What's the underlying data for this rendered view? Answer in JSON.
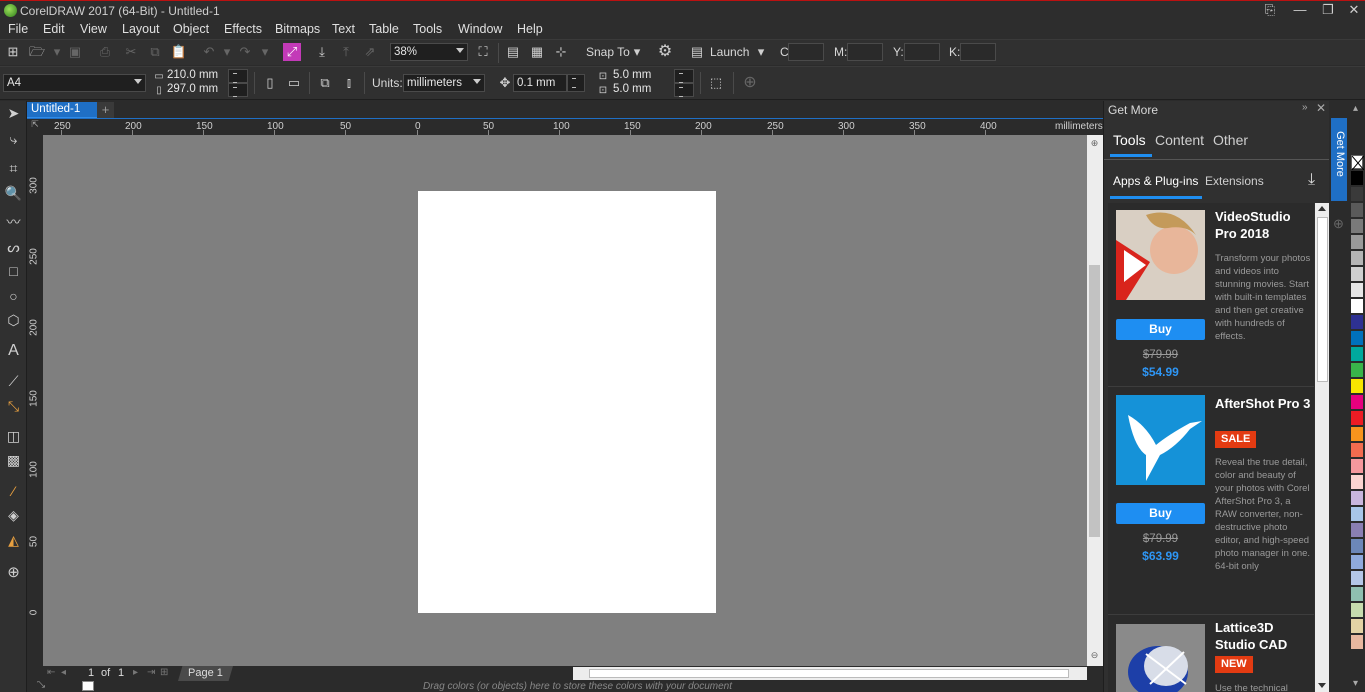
{
  "window": {
    "title": "CorelDRAW 2017 (64-Bit) - Untitled-1"
  },
  "menu": [
    "File",
    "Edit",
    "View",
    "Layout",
    "Object",
    "Effects",
    "Bitmaps",
    "Text",
    "Table",
    "Tools",
    "Window",
    "Help"
  ],
  "toolbar": {
    "zoom": "38%",
    "snap_to": "Snap To",
    "launch": "Launch",
    "x_label": "C:",
    "m_label": "M:",
    "y_label": "Y:",
    "k_label": "K:"
  },
  "properties": {
    "page_size": "A4",
    "width": "210.0 mm",
    "height": "297.0 mm",
    "units_label": "Units:",
    "units": "millimeters",
    "nudge": "0.1 mm",
    "dup_x": "5.0 mm",
    "dup_y": "5.0 mm"
  },
  "document": {
    "tab": "Untitled-1",
    "ruler_unit": "millimeters",
    "h_ruler_labels": [
      "250",
      "200",
      "150",
      "100",
      "50",
      "0",
      "50",
      "100",
      "150",
      "200",
      "250",
      "300",
      "350",
      "400"
    ],
    "v_ruler_labels": [
      "300",
      "250",
      "200",
      "150",
      "100",
      "50",
      "0"
    ],
    "page_nav": {
      "current": "1",
      "of": "of",
      "total": "1"
    },
    "page_tab": "Page 1",
    "status_hint": "Drag colors (or objects) here to store these colors with your document"
  },
  "get_more": {
    "title": "Get More",
    "side_tab": "Get More",
    "tabs": [
      "Tools",
      "Content",
      "Other"
    ],
    "subtabs": [
      "Apps & Plug-ins",
      "Extensions"
    ],
    "products": [
      {
        "name": "VideoStudio Pro 2018",
        "badge": "",
        "desc": "Transform your photos and videos into stunning movies. Start with built-in templates and then get creative with hundreds of effects.",
        "buy": "Buy",
        "old_price": "$79.99",
        "new_price": "$54.99"
      },
      {
        "name": "AfterShot Pro 3",
        "badge": "SALE",
        "desc": "Reveal the true detail, color and beauty of your photos with Corel AfterShot Pro 3, a RAW converter, non-destructive photo editor, and high-speed photo manager in one. 64-bit only",
        "buy": "Buy",
        "old_price": "$79.99",
        "new_price": "$63.99"
      },
      {
        "name": "Lattice3D Studio CAD",
        "badge": "NEW",
        "desc": "Use the technical",
        "buy": "",
        "old_price": "",
        "new_price": ""
      }
    ]
  },
  "colors": {
    "accent": "#1f6fc5",
    "canvas": "#7f7f7f",
    "buy_button": "#1e8ef2",
    "badge": "#e33b12"
  },
  "palette": [
    "#000000",
    "#3a3a3a",
    "#5a5a5a",
    "#7a7a7a",
    "#9a9a9a",
    "#b5b5b5",
    "#cfcfcf",
    "#e6e6e6",
    "#ffffff",
    "#2e3192",
    "#0071bc",
    "#00a99d",
    "#39b54a",
    "#f7e600",
    "#e6007e",
    "#ed1c24",
    "#f7941d",
    "#f26c4f",
    "#f5989d",
    "#fbd4d1",
    "#c9b6dd",
    "#a8c6e8",
    "#8a7fb3",
    "#6c87b8",
    "#8faadc",
    "#b4c7e7",
    "#8fbfb0",
    "#c6dcae",
    "#e3d3a5",
    "#e8b8a0"
  ]
}
